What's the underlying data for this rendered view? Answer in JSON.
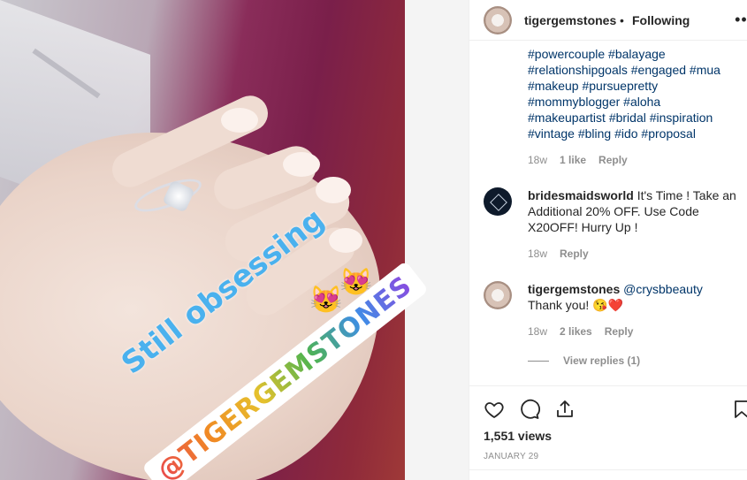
{
  "media": {
    "sticker_text": "Still obsessing",
    "sticker_tag": "@TIGERGEMSTONES",
    "emoji_1": "😻",
    "emoji_2": "😻"
  },
  "post": {
    "author": "tigergemstones",
    "separator": "•",
    "follow_status": "Following",
    "more_icon": "•••"
  },
  "caption": {
    "hashtags": "#powercouple #balayage #relationshipgoals #engaged #mua #makeup #pursuepretty #mommyblogger #aloha #makeupartist #bridal #inspiration #vintage #bling #ido #proposal",
    "time": "18w",
    "likes": "1 like",
    "reply": "Reply"
  },
  "comments": [
    {
      "user": "bridesmaidsworld",
      "text": " It's Time ! Take an Additional 20% OFF. Use Code X20OFF! Hurry Up !",
      "time": "18w",
      "reply": "Reply"
    },
    {
      "user": "tigergemstones",
      "mention": " @crysbbeauty",
      "text": "Thank you! 😘❤️",
      "time": "18w",
      "likes": "2 likes",
      "reply": "Reply"
    }
  ],
  "view_replies": "View replies (1)",
  "footer": {
    "views": "1,551 views",
    "date": "JANUARY 29"
  },
  "icons": {
    "like": "heart-icon",
    "comment": "comment-icon",
    "share": "share-icon",
    "save": "bookmark-icon"
  }
}
